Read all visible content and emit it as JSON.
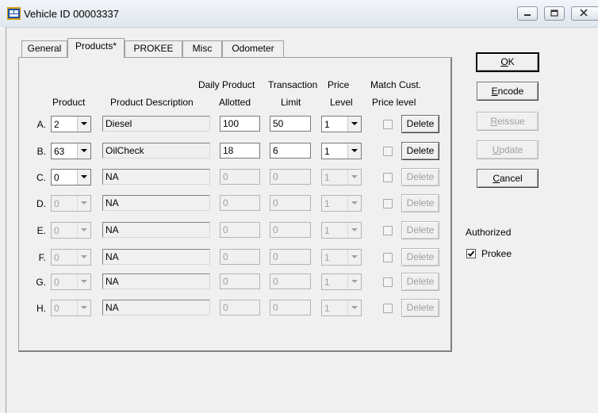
{
  "window": {
    "title": "Vehicle ID 00003337"
  },
  "tabs": [
    "General",
    "Products*",
    "PROKEE",
    "Misc",
    "Odometer"
  ],
  "headers": {
    "product": "Product",
    "description": "Product Description",
    "daily_line1": "Daily Product",
    "daily_line2": "Allotted",
    "trans_line1": "Transaction",
    "trans_line2": "Limit",
    "price_line1": "Price",
    "price_line2": "Level",
    "match_line1": "Match Cust.",
    "match_line2": "Price level"
  },
  "rows": [
    {
      "label": "A.",
      "product": "2",
      "description": "Diesel",
      "allotted": "100",
      "limit": "50",
      "price_level": "1",
      "delete": "Delete",
      "enabled": true
    },
    {
      "label": "B.",
      "product": "63",
      "description": "OilCheck",
      "allotted": "18",
      "limit": "6",
      "price_level": "1",
      "delete": "Delete",
      "enabled": true
    },
    {
      "label": "C.",
      "product": "0",
      "description": "NA",
      "allotted": "0",
      "limit": "0",
      "price_level": "1",
      "delete": "Delete",
      "enabled": false,
      "product_enabled": true
    },
    {
      "label": "D.",
      "product": "0",
      "description": "NA",
      "allotted": "0",
      "limit": "0",
      "price_level": "1",
      "delete": "Delete",
      "enabled": false
    },
    {
      "label": "E.",
      "product": "0",
      "description": "NA",
      "allotted": "0",
      "limit": "0",
      "price_level": "1",
      "delete": "Delete",
      "enabled": false
    },
    {
      "label": "F.",
      "product": "0",
      "description": "NA",
      "allotted": "0",
      "limit": "0",
      "price_level": "1",
      "delete": "Delete",
      "enabled": false
    },
    {
      "label": "G.",
      "product": "0",
      "description": "NA",
      "allotted": "0",
      "limit": "0",
      "price_level": "1",
      "delete": "Delete",
      "enabled": false
    },
    {
      "label": "H.",
      "product": "0",
      "description": "NA",
      "allotted": "0",
      "limit": "0",
      "price_level": "1",
      "delete": "Delete",
      "enabled": false
    }
  ],
  "buttons": {
    "ok": {
      "mn": "O",
      "rest": "K"
    },
    "encode": {
      "mn": "E",
      "rest": "ncode"
    },
    "reissue": {
      "mn": "R",
      "rest": "eissue"
    },
    "update": {
      "mn": "U",
      "rest": "pdate"
    },
    "cancel": {
      "mn": "C",
      "rest": "ancel"
    }
  },
  "authorized": {
    "label": "Authorized",
    "prokee_label": "Prokee",
    "prokee_checked": true
  }
}
